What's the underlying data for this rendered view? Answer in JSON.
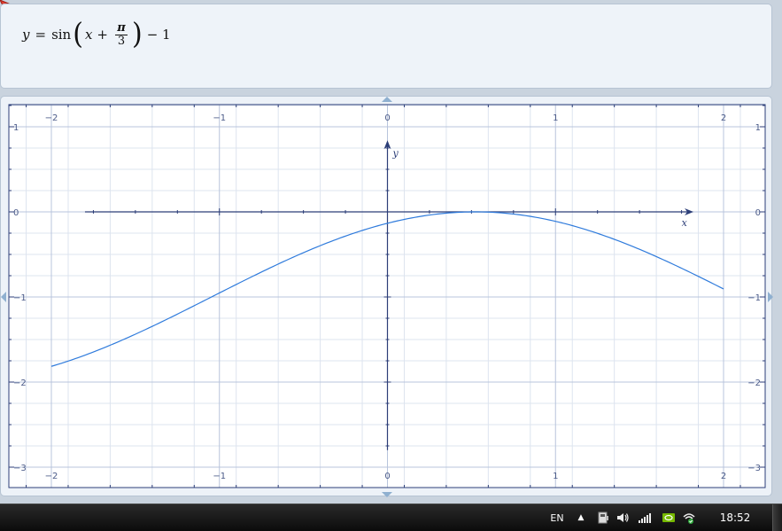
{
  "formula": {
    "lhs": "y",
    "eq": "=",
    "func": "sin",
    "var": "x",
    "plus": "+",
    "num": "π",
    "den": "3",
    "minus": "− 1"
  },
  "plot": {
    "x_ticks": [
      "−2",
      "−1",
      "0",
      "1",
      "2"
    ],
    "y_ticks": [
      "1",
      "0",
      "−1",
      "−2",
      "−3"
    ],
    "x_axis_label": "x",
    "y_axis_label": "y"
  },
  "chart_data": {
    "type": "line",
    "function": "y = sin(x + π/3) − 1",
    "xlim": [
      -2,
      2
    ],
    "ylim": [
      -3,
      1
    ],
    "xlabel": "x",
    "ylabel": "y",
    "x_ticks": [
      -2,
      -1,
      0,
      1,
      2
    ],
    "y_ticks": [
      1,
      0,
      -1,
      -2,
      -3
    ],
    "grid": true,
    "x": [
      -2,
      -1.5,
      -1,
      -0.5,
      0,
      0.5,
      1,
      1.5,
      2
    ],
    "y": [
      -1.81,
      -1.5,
      -0.96,
      -0.42,
      -0.13,
      0,
      -0.13,
      -0.42,
      -0.89
    ]
  },
  "colors": {
    "curve": "#2f7bdc",
    "axis": "#2c3e78",
    "grid_major": "#b8c4dc",
    "grid_minor": "#dde4ef",
    "frame": "#2c3e78",
    "tick_label": "#4a5a88"
  },
  "taskbar": {
    "language": "EN",
    "show_hidden": "▲",
    "clock": "18:52",
    "icons": [
      "device-icon",
      "speaker-icon",
      "signal-bars-icon",
      "nvidia-icon",
      "network-icon"
    ]
  }
}
